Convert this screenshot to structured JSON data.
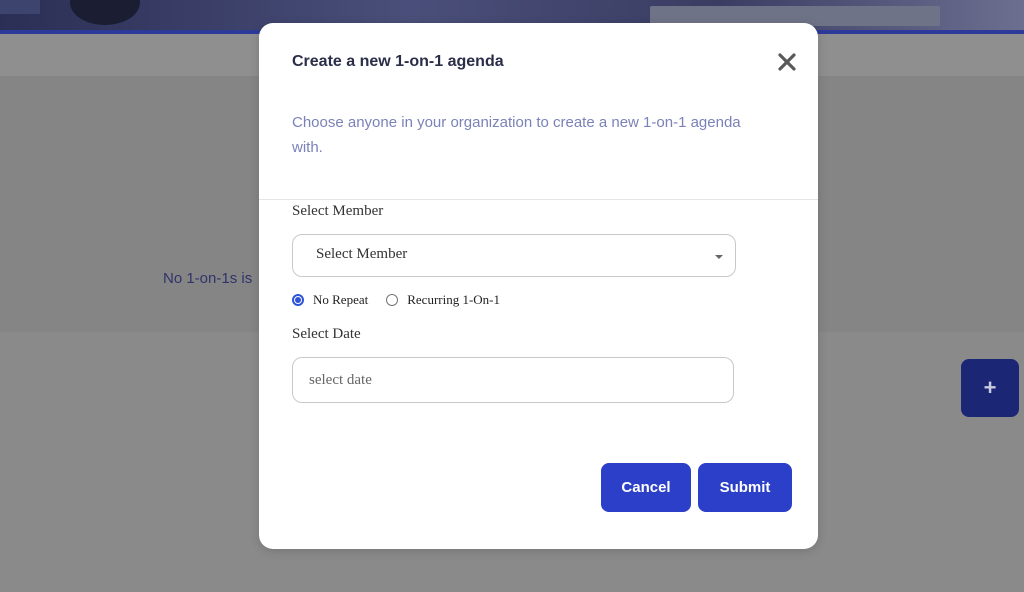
{
  "background": {
    "empty_message": "No 1-on-1s is",
    "fab_label": "+"
  },
  "modal": {
    "title": "Create a new 1-on-1 agenda",
    "description": "Choose anyone in your organization to create a new 1-on-1 agenda with.",
    "member_label": "Select Member",
    "member_select": {
      "selected": "Select Member"
    },
    "repeat_options": [
      {
        "label": "No Repeat",
        "checked": true
      },
      {
        "label": "Recurring 1-On-1",
        "checked": false
      }
    ],
    "date_label": "Select Date",
    "date_input": {
      "value": "",
      "placeholder": "select date"
    },
    "cancel_label": "Cancel",
    "submit_label": "Submit"
  },
  "colors": {
    "primary": "#2c3fc8",
    "fab": "#1b2775",
    "description_text": "#7a82b8",
    "radio_accent": "#2f54d6"
  },
  "icons": [
    "close-icon",
    "plus-icon",
    "chevron-down-icon"
  ]
}
